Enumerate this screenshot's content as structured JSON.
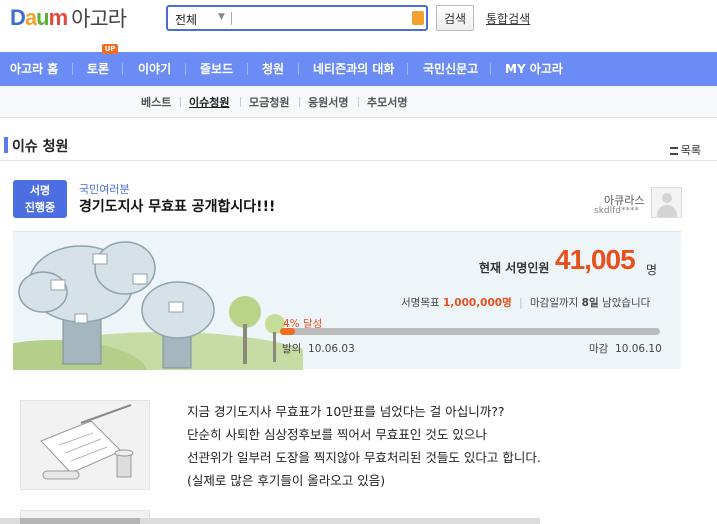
{
  "header": {
    "logo_text": "Daum",
    "service_name": "아고라",
    "search_scope": "전체",
    "search_value": "",
    "search_button": "검색",
    "total_search": "통합검색"
  },
  "nav": {
    "items": [
      {
        "label": "아고라 홈"
      },
      {
        "label": "토론"
      },
      {
        "label": "이야기"
      },
      {
        "label": "즐보드"
      },
      {
        "label": "청원"
      },
      {
        "label": "네티즌과의 대화"
      },
      {
        "label": "국민신문고"
      },
      {
        "label": "MY 아고라"
      }
    ],
    "badge": "UP"
  },
  "subnav": {
    "items": [
      {
        "label": "베스트"
      },
      {
        "label": "이슈청원"
      },
      {
        "label": "모금청원"
      },
      {
        "label": "응원서명"
      },
      {
        "label": "추모서명"
      }
    ],
    "active_index": 1
  },
  "page": {
    "title": "이슈 청원",
    "list_link": "목록"
  },
  "petition": {
    "status_line1": "서명",
    "status_line2": "진행중",
    "category": "국민여러분",
    "title": "경기도지사 무효표 공개합시다!!!",
    "author_name": "아큐라스",
    "author_id": "skdlfd****",
    "count_label": "현재 서명인원",
    "count_value": "41,005",
    "count_unit": "명",
    "goal_label": "서명목표",
    "goal_value": "1,000,000명",
    "deadline_prefix": "마감일까지",
    "days_left": "8일",
    "deadline_suffix": "남았습니다",
    "achieve_text": "4% 달성",
    "progress_fraction": 0.04,
    "start_label": "발의",
    "start_date": "10.06.03",
    "end_label": "마감",
    "end_date": "10.06.10"
  },
  "content": {
    "lines": [
      "지금 경기도지사 무효표가 10만표를 넘었다는 걸 아십니까??",
      "단순히 사퇴한 심상정후보를 찍어서 무효표인 것도 있으나",
      "선관위가 일부러 도장을 찍지않아 무효처리된 것들도 있다고 합니다.",
      "(실제로 많은 후기들이 올라오고 있음)"
    ]
  },
  "colors": {
    "nav_bg": "#6c8cf5",
    "accent": "#4d6ee0",
    "count": "#e8501e",
    "progress": "#f26d21"
  }
}
